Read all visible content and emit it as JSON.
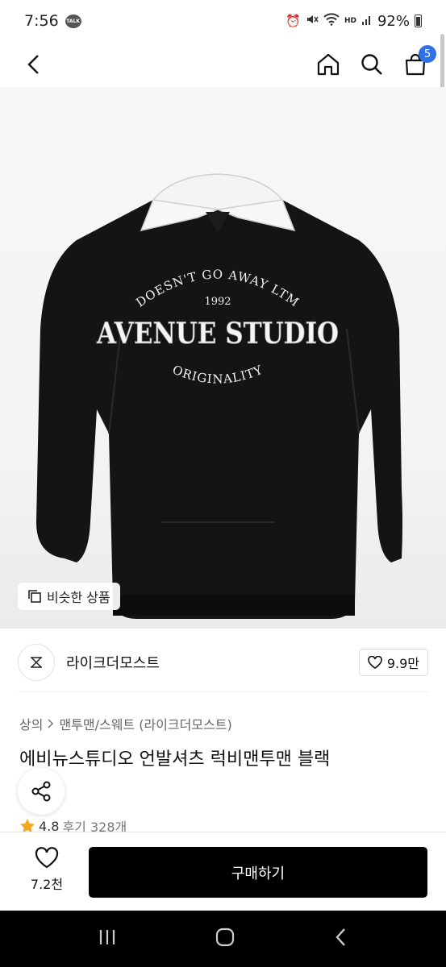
{
  "status_bar": {
    "time": "7:56",
    "talk_label": "TALK",
    "battery": "92%",
    "hd_label": "HD"
  },
  "nav": {
    "cart_count": "5"
  },
  "product": {
    "similar_label": "비슷한 상품",
    "print": {
      "arc_top": "DOESN'T GO AWAY LTM",
      "year": "1992",
      "main": "AVENUE STUDIO",
      "arc_bottom": "ORIGINALITY"
    }
  },
  "brand": {
    "name": "라이크더모스트",
    "likes": "9.9만"
  },
  "breadcrumb": {
    "level1": "상의",
    "level2": "맨투맨/스웨트 (라이크더모스트)"
  },
  "title": "에비뉴스튜디오 언발셔츠 럭비맨투맨 블랙",
  "rating": {
    "score": "4.8",
    "reviews": "후기 328개"
  },
  "bottom": {
    "wish_count": "7.2천",
    "buy_label": "구매하기"
  }
}
